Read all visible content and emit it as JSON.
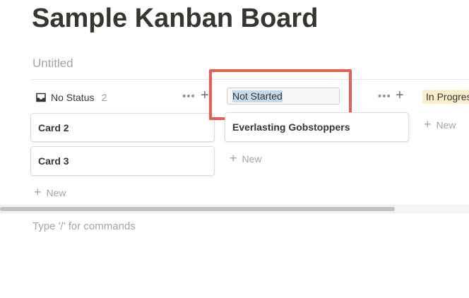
{
  "page": {
    "title": "Sample Kanban Board",
    "view_name": "Untitled"
  },
  "columns": [
    {
      "label": "No Status",
      "count": "2",
      "cards": [
        "Card 2",
        "Card 3"
      ],
      "new_label": "New"
    },
    {
      "label": "Not Started",
      "cards": [
        "Everlasting Gobstoppers"
      ],
      "new_label": "New"
    },
    {
      "label": "In Progress",
      "new_label": "New"
    }
  ],
  "header_actions": {
    "more": "•••",
    "add": "+"
  },
  "editor": {
    "placeholder": "Type '/' for commands"
  },
  "colors": {
    "highlight": "#e65d51",
    "selection": "#c5d9ee",
    "in_progress_tag": "#fbeecc"
  },
  "icons": [
    "inbox-icon",
    "more-icon",
    "plus-icon"
  ]
}
